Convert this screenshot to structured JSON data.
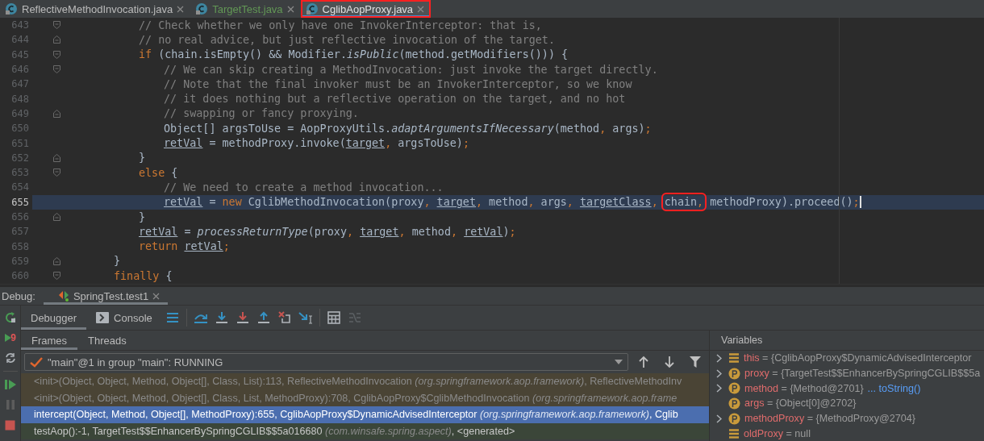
{
  "tabs": [
    {
      "label": "ReflectiveMethodInvocation.java",
      "selected": false,
      "kind": "unchanged",
      "annotated": false
    },
    {
      "label": "TargetTest.java",
      "selected": false,
      "kind": "added",
      "annotated": false
    },
    {
      "label": "CglibAopProxy.java",
      "selected": true,
      "kind": "unchanged",
      "annotated": true
    }
  ],
  "editor": {
    "lines": [
      {
        "children": [
          {
            "number": "643",
            "kind": "fold-open",
            "current": false,
            "tokens": [
              {
                "t": "// Check whether we only have one InvokerInterceptor: that is,",
                "kind": "comment"
              }
            ]
          },
          {
            "number": "644",
            "kind": "fold-close",
            "current": false,
            "tokens": [
              {
                "t": "// no real advice, but just reflective invocation of the target.",
                "kind": "comment"
              }
            ]
          },
          {
            "number": "645",
            "kind": "fold-open",
            "current": false,
            "tokens": [
              {
                "t": "if ",
                "kind": "keyword"
              },
              {
                "t": "(chain.isEmpty() && Modifier.",
                "kind": "plain"
              },
              {
                "t": "isPublic",
                "kind": "italic"
              },
              {
                "t": "(method.getModifiers())) {",
                "kind": "plain"
              }
            ]
          },
          {
            "children": [
              {
                "number": "646",
                "kind": "fold-open",
                "current": false,
                "tokens": [
                  {
                    "t": "// We can skip creating a MethodInvocation: just invoke the target directly.",
                    "kind": "comment"
                  }
                ]
              },
              {
                "number": "647",
                "kind": "plain",
                "current": false,
                "tokens": [
                  {
                    "t": "// Note that the final invoker must be an InvokerInterceptor, so we know",
                    "kind": "comment"
                  }
                ]
              },
              {
                "number": "648",
                "kind": "plain",
                "current": false,
                "tokens": [
                  {
                    "t": "// it does nothing but a reflective operation on the target, and no hot",
                    "kind": "comment"
                  }
                ]
              },
              {
                "number": "649",
                "kind": "fold-close",
                "current": false,
                "tokens": [
                  {
                    "t": "// swapping or fancy proxying.",
                    "kind": "comment"
                  }
                ]
              },
              {
                "number": "650",
                "kind": "plain",
                "current": false,
                "tokens": [
                  {
                    "t": "Object[] argsToUse = AopProxyUtils.",
                    "kind": "plain"
                  },
                  {
                    "t": "adaptArgumentsIfNecessary",
                    "kind": "italic"
                  },
                  {
                    "t": "(method",
                    "kind": "plain"
                  },
                  {
                    "t": ", ",
                    "kind": "punct"
                  },
                  {
                    "t": "args)",
                    "kind": "plain"
                  },
                  {
                    "t": ";",
                    "kind": "punct"
                  }
                ]
              },
              {
                "number": "651",
                "kind": "plain",
                "current": false,
                "tokens": [
                  {
                    "t": "retVal",
                    "kind": "field"
                  },
                  {
                    "t": " = methodProxy.invoke(",
                    "kind": "plain"
                  },
                  {
                    "t": "target",
                    "kind": "field"
                  },
                  {
                    "t": ", ",
                    "kind": "punct"
                  },
                  {
                    "t": "argsToUse)",
                    "kind": "plain"
                  },
                  {
                    "t": ";",
                    "kind": "punct"
                  }
                ]
              }
            ]
          },
          {
            "number": "652",
            "kind": "fold-close",
            "current": false,
            "tokens": [
              {
                "t": "}",
                "kind": "plain"
              }
            ]
          },
          {
            "number": "653",
            "kind": "fold-open",
            "current": false,
            "tokens": [
              {
                "t": "else ",
                "kind": "keyword"
              },
              {
                "t": "{",
                "kind": "plain"
              }
            ]
          },
          {
            "children": [
              {
                "number": "654",
                "kind": "plain",
                "current": false,
                "tokens": [
                  {
                    "t": "// We need to create a method invocation...",
                    "kind": "comment"
                  }
                ]
              },
              {
                "number": "655",
                "kind": "plain",
                "current": true,
                "tokens": [
                  {
                    "t": "retVal",
                    "kind": "field"
                  },
                  {
                    "t": " = ",
                    "kind": "plain"
                  },
                  {
                    "t": "new ",
                    "kind": "keyword"
                  },
                  {
                    "t": "CglibMethodInvocation(proxy",
                    "kind": "plain"
                  },
                  {
                    "t": ", ",
                    "kind": "punct"
                  },
                  {
                    "t": "target",
                    "kind": "field"
                  },
                  {
                    "t": ", ",
                    "kind": "punct"
                  },
                  {
                    "t": "method",
                    "kind": "plain"
                  },
                  {
                    "t": ", ",
                    "kind": "punct"
                  },
                  {
                    "t": "args",
                    "kind": "plain"
                  },
                  {
                    "t": ", ",
                    "kind": "punct"
                  },
                  {
                    "t": "targetClass",
                    "kind": "field"
                  },
                  {
                    "t": ", ",
                    "kind": "punct"
                  },
                  {
                    "kind": "box",
                    "children": [
                      {
                        "t": "chain",
                        "kind": "plain"
                      },
                      {
                        "t": ",",
                        "kind": "punct"
                      }
                    ]
                  },
                  {
                    "t": " methodProxy).proceed()",
                    "kind": "plain"
                  },
                  {
                    "t": ";",
                    "kind": "punct"
                  }
                ]
              }
            ]
          },
          {
            "number": "656",
            "kind": "fold-close",
            "current": false,
            "tokens": [
              {
                "t": "}",
                "kind": "plain"
              }
            ]
          },
          {
            "number": "657",
            "kind": "plain",
            "current": false,
            "tokens": [
              {
                "t": "retVal",
                "kind": "field"
              },
              {
                "t": " = ",
                "kind": "plain"
              },
              {
                "t": "processReturnType",
                "kind": "italic"
              },
              {
                "t": "(proxy",
                "kind": "plain"
              },
              {
                "t": ", ",
                "kind": "punct"
              },
              {
                "t": "target",
                "kind": "field"
              },
              {
                "t": ", ",
                "kind": "punct"
              },
              {
                "t": "method",
                "kind": "plain"
              },
              {
                "t": ", ",
                "kind": "punct"
              },
              {
                "t": "retVal",
                "kind": "field"
              },
              {
                "t": ")",
                "kind": "plain"
              },
              {
                "t": ";",
                "kind": "punct"
              }
            ]
          },
          {
            "number": "658",
            "kind": "plain",
            "current": false,
            "tokens": [
              {
                "t": "return ",
                "kind": "keyword"
              },
              {
                "t": "retVal",
                "kind": "field"
              },
              {
                "t": ";",
                "kind": "punct"
              }
            ]
          }
        ]
      },
      {
        "number": "659",
        "kind": "fold-close",
        "current": false,
        "tokens": [
          {
            "t": "}",
            "kind": "plain"
          }
        ]
      },
      {
        "number": "660",
        "kind": "fold-open",
        "current": false,
        "tokens": [
          {
            "t": "finally ",
            "kind": "keyword"
          },
          {
            "t": "{",
            "kind": "plain"
          }
        ]
      }
    ]
  },
  "debug": {
    "label": "Debug:",
    "session_tab": {
      "label": "SpringTest.test1",
      "selected": true
    },
    "side_toolbar": [
      {
        "kind": "rerun",
        "disabled": false
      },
      {
        "kind": "run-badge",
        "badge": "9",
        "disabled": false
      },
      {
        "kind": "toggle",
        "disabled": false
      },
      {
        "kind": "resume",
        "disabled": false
      },
      {
        "kind": "pause",
        "disabled": true
      },
      {
        "kind": "stop",
        "disabled": false
      }
    ],
    "view_tabs": [
      {
        "label": "Debugger",
        "kind": "debugger",
        "selected": true
      },
      {
        "label": "Console",
        "kind": "console",
        "selected": false
      }
    ],
    "toolbar": [
      {
        "kind": "layout",
        "disabled": false
      },
      {
        "kind": "step-over",
        "disabled": false
      },
      {
        "kind": "step-into",
        "disabled": false
      },
      {
        "kind": "force-step-into",
        "disabled": false
      },
      {
        "kind": "step-out",
        "disabled": false
      },
      {
        "kind": "drop-frame",
        "disabled": false
      },
      {
        "kind": "run-to-cursor",
        "disabled": false
      },
      {
        "kind": "evaluate",
        "disabled": false
      },
      {
        "kind": "trace",
        "disabled": true
      }
    ],
    "frames_tabs": [
      {
        "label": "Frames",
        "selected": true
      },
      {
        "label": "Threads",
        "selected": false
      }
    ],
    "thread": {
      "value": "\"main\"@1 in group \"main\": RUNNING"
    },
    "frames": [
      {
        "text": "<init>(Object, Object, Method, Object[], Class, List):113, ReflectiveMethodInvocation",
        "package": "(org.springframework.aop.framework)",
        "tail": ", ReflectiveMethodInv",
        "kind": "library",
        "selected": false
      },
      {
        "text": "<init>(Object, Object, Method, Object[], Class, List, MethodProxy):708, CglibAopProxy$CglibMethodInvocation",
        "package": "(org.springframework.aop.frame",
        "kind": "library",
        "selected": false
      },
      {
        "text": "intercept(Object, Method, Object[], MethodProxy):655, CglibAopProxy$DynamicAdvisedInterceptor",
        "package": "(org.springframework.aop.framework)",
        "tail": ", Cglib",
        "kind": "project",
        "selected": true
      },
      {
        "text": "testAop():-1, TargetTest$$EnhancerBySpringCGLIB$$5a016680",
        "package": "(com.winsafe.spring.aspect)",
        "tail": ", <generated>",
        "kind": "project",
        "selected": false
      }
    ],
    "variables": {
      "title": "Variables",
      "items": [
        {
          "name": "this",
          "equals": "=",
          "value": "{CglibAopProxy$DynamicAdvisedInterceptor",
          "kind": "field",
          "expandable": true
        },
        {
          "name": "proxy",
          "equals": "=",
          "value": "{TargetTest$$EnhancerBySpringCGLIB$$5a",
          "kind": "param",
          "expandable": true
        },
        {
          "name": "method",
          "equals": "=",
          "value": "{Method@2701}",
          "link": "... toString()",
          "kind": "param",
          "expandable": true
        },
        {
          "name": "args",
          "equals": "=",
          "value": "{Object[0]@2702}",
          "kind": "param",
          "expandable": false
        },
        {
          "name": "methodProxy",
          "equals": "=",
          "value": "{MethodProxy@2704}",
          "kind": "param",
          "expandable": true
        },
        {
          "name": "oldProxy",
          "equals": "=",
          "value": "null",
          "kind": "field",
          "expandable": false
        }
      ]
    }
  }
}
